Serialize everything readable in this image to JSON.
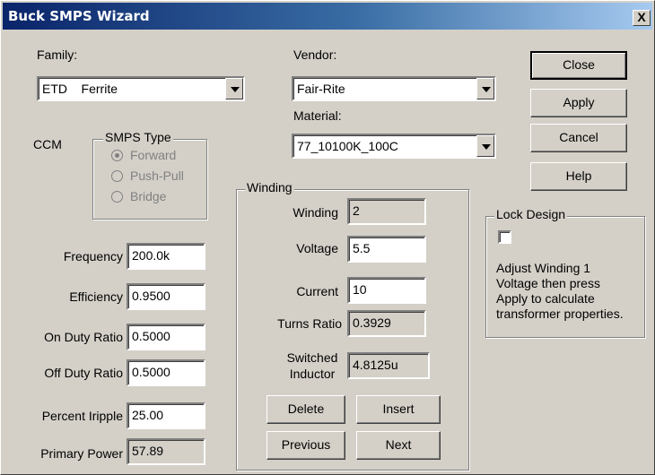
{
  "window": {
    "title": "Buck SMPS Wizard",
    "close_glyph": "X"
  },
  "family": {
    "label": "Family:",
    "value": "ETD    Ferrite"
  },
  "vendor": {
    "label": "Vendor:",
    "value": "Fair-Rite"
  },
  "material": {
    "label": "Material:",
    "value": "77_10100K_100C"
  },
  "buttons": {
    "close": "Close",
    "apply": "Apply",
    "cancel": "Cancel",
    "help": "Help"
  },
  "mode_label": "CCM",
  "smps_type": {
    "title": "SMPS Type",
    "options": [
      "Forward",
      "Push-Pull",
      "Bridge"
    ],
    "selected": "Forward"
  },
  "params": {
    "frequency": {
      "label": "Frequency",
      "value": "200.0k"
    },
    "efficiency": {
      "label": "Efficiency",
      "value": "0.9500"
    },
    "on_duty": {
      "label": "On Duty Ratio",
      "value": "0.5000"
    },
    "off_duty": {
      "label": "Off Duty Ratio",
      "value": "0.5000"
    },
    "ripple": {
      "label": "Percent Iripple",
      "value": "25.00"
    },
    "primary_power": {
      "label": "Primary Power",
      "value": "57.89"
    }
  },
  "winding": {
    "title": "Winding",
    "winding": {
      "label": "Winding",
      "value": "2"
    },
    "voltage": {
      "label": "Voltage",
      "value": "5.5"
    },
    "current": {
      "label": "Current",
      "value": "10"
    },
    "turns_ratio": {
      "label": "Turns Ratio",
      "value": "0.3929"
    },
    "switched_inductor": {
      "label_1": "Switched",
      "label_2": "Inductor",
      "value": "4.8125u"
    },
    "buttons": {
      "delete": "Delete",
      "insert": "Insert",
      "previous": "Previous",
      "next": "Next"
    }
  },
  "lock_design": {
    "title": "Lock Design",
    "checked": false,
    "text_lines": [
      "Adjust Winding 1",
      "Voltage then press",
      "Apply to calculate",
      "transformer properties."
    ]
  }
}
